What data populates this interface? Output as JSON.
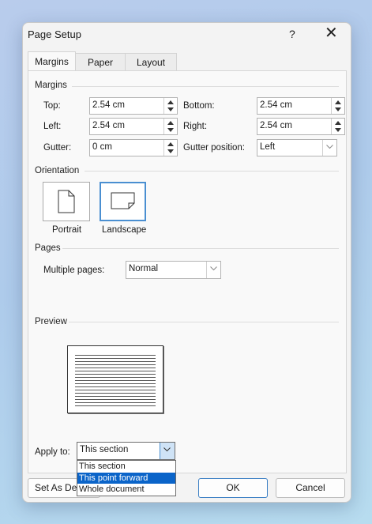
{
  "dialog": {
    "title": "Page Setup",
    "help": "?",
    "close": "✕"
  },
  "tabs": [
    {
      "label": "Margins"
    },
    {
      "label": "Paper"
    },
    {
      "label": "Layout"
    }
  ],
  "margins": {
    "section": "Margins",
    "top": {
      "label": "Top:",
      "value": "2.54 cm"
    },
    "bottom": {
      "label": "Bottom:",
      "value": "2.54 cm"
    },
    "left": {
      "label": "Left:",
      "value": "2.54 cm"
    },
    "right": {
      "label": "Right:",
      "value": "2.54 cm"
    },
    "gutter": {
      "label": "Gutter:",
      "value": "0 cm"
    },
    "gutter_position": {
      "label": "Gutter position:",
      "value": "Left"
    }
  },
  "orientation": {
    "section": "Orientation",
    "portrait": "Portrait",
    "landscape": "Landscape",
    "selected": "Landscape"
  },
  "pages": {
    "section": "Pages",
    "multiple_label": "Multiple pages:",
    "multiple_value": "Normal"
  },
  "preview": {
    "section": "Preview"
  },
  "apply": {
    "label": "Apply to:",
    "value": "This section",
    "options": [
      "This section",
      "This point forward",
      "Whole document"
    ],
    "highlighted": "This point forward"
  },
  "buttons": {
    "set_default": "Set As Default",
    "ok": "OK",
    "cancel": "Cancel"
  },
  "colors": {
    "accent": "#0a64c9",
    "selection_border": "#4a8fd1"
  }
}
